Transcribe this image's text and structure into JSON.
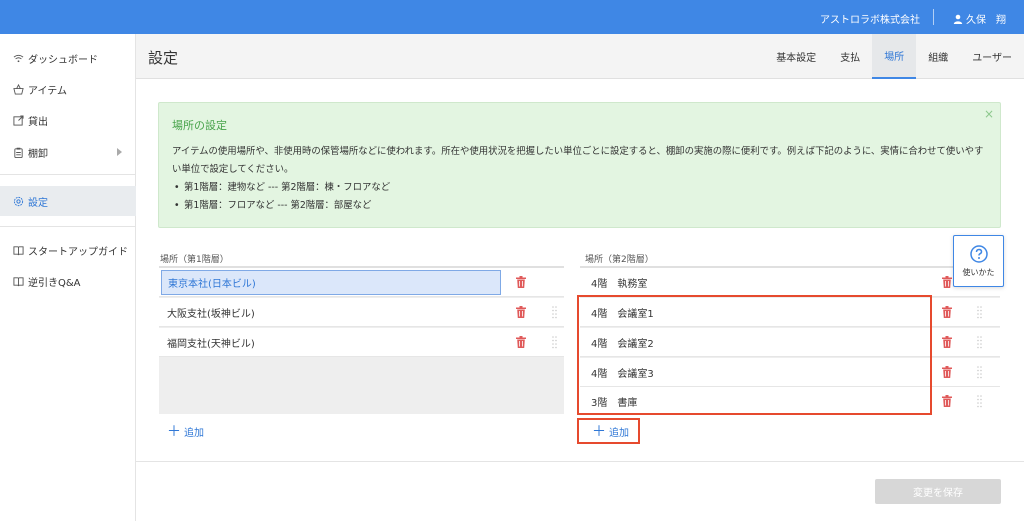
{
  "topbar": {
    "company": "アストロラボ株式会社",
    "user": "久保　翔",
    "brand_color": "#3f87e5"
  },
  "sidebar": {
    "items": [
      {
        "label": "ダッシュボード",
        "icon": "wifi-icon"
      },
      {
        "label": "アイテム",
        "icon": "basket-icon"
      },
      {
        "label": "貸出",
        "icon": "external-link-icon"
      },
      {
        "label": "棚卸",
        "icon": "clipboard-icon"
      },
      {
        "label": "設定",
        "icon": "gear-icon"
      },
      {
        "label": "スタートアップガイド",
        "icon": "book-icon"
      },
      {
        "label": "逆引きQ&A",
        "icon": "book-icon"
      }
    ]
  },
  "header": {
    "title": "設定",
    "tabs": [
      {
        "label": "基本設定"
      },
      {
        "label": "支払"
      },
      {
        "label": "場所"
      },
      {
        "label": "組織"
      },
      {
        "label": "ユーザー"
      }
    ]
  },
  "info": {
    "title": "場所の設定",
    "body_line1": "アイテムの使用場所や、非使用時の保管場所などに使われます。所在や使用状況を把握したい単位ごとに設定すると、棚卸の実施の際に便利です。例えば下記のように、実情に合わせて使いやすい単位で設定してください。",
    "bullets": [
      "第1階層：建物など --- 第2階層：棟・フロアなど",
      "第1階層：フロアなど --- 第2階層：部屋など"
    ],
    "close": "×"
  },
  "level1": {
    "label": "場所（第1階層）",
    "rows": [
      {
        "name": "東京本社(日本ビル)"
      },
      {
        "name": "大阪支社(坂神ビル)"
      },
      {
        "name": "福岡支社(天神ビル)"
      }
    ],
    "add_label": "追加"
  },
  "level2": {
    "label": "場所（第2階層）",
    "rows": [
      {
        "name": "4階　執務室"
      },
      {
        "name": "4階　会議室1"
      },
      {
        "name": "4階　会議室2"
      },
      {
        "name": "4階　会議室3"
      },
      {
        "name": "3階　書庫"
      }
    ],
    "add_label": "追加"
  },
  "help": {
    "label": "使いかた",
    "icon": "question-circle-icon"
  },
  "save_button": {
    "label": "変更を保存"
  },
  "colors": {
    "accent": "#3f87e5",
    "trash": "#e05a5a",
    "highlight": "#e64a2e",
    "info_bg": "#e3f5e1",
    "info_title": "#47a34a"
  }
}
